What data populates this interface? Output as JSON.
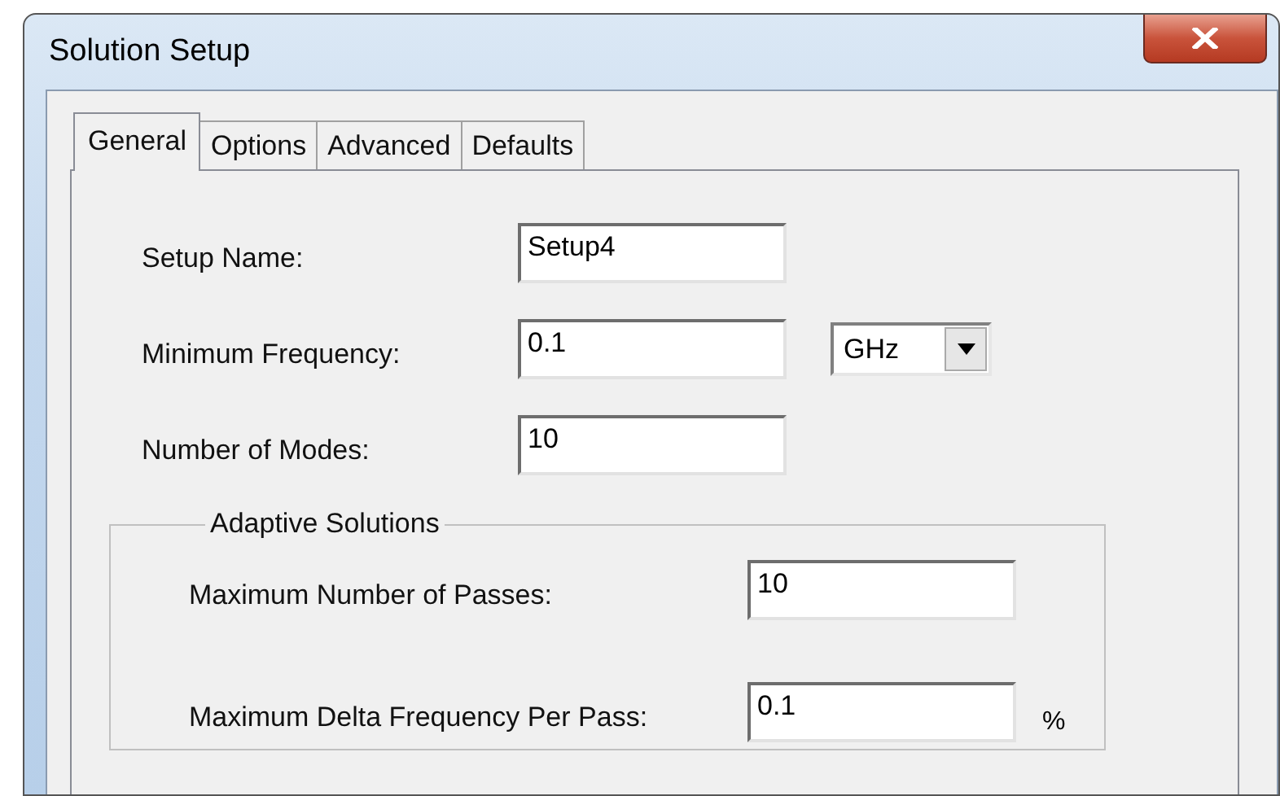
{
  "window": {
    "title": "Solution Setup"
  },
  "tabs": [
    {
      "label": "General",
      "selected": true
    },
    {
      "label": "Options",
      "selected": false
    },
    {
      "label": "Advanced",
      "selected": false
    },
    {
      "label": "Defaults",
      "selected": false
    }
  ],
  "fields": [
    {
      "kind": "text",
      "label": "Setup Name:",
      "value": "Setup4"
    },
    {
      "kind": "text-with-select",
      "label": "Minimum Frequency:",
      "value": "0.1",
      "select": "GHz"
    },
    {
      "kind": "text",
      "label": "Number of Modes:",
      "value": "10"
    }
  ],
  "group": {
    "title": "Adaptive Solutions",
    "fields": [
      {
        "kind": "text",
        "label": "Maximum Number of Passes:",
        "value": "10"
      },
      {
        "kind": "text-with-unit",
        "label": "Maximum Delta Frequency Per Pass:",
        "value": "0.1",
        "unit": "%"
      }
    ]
  }
}
